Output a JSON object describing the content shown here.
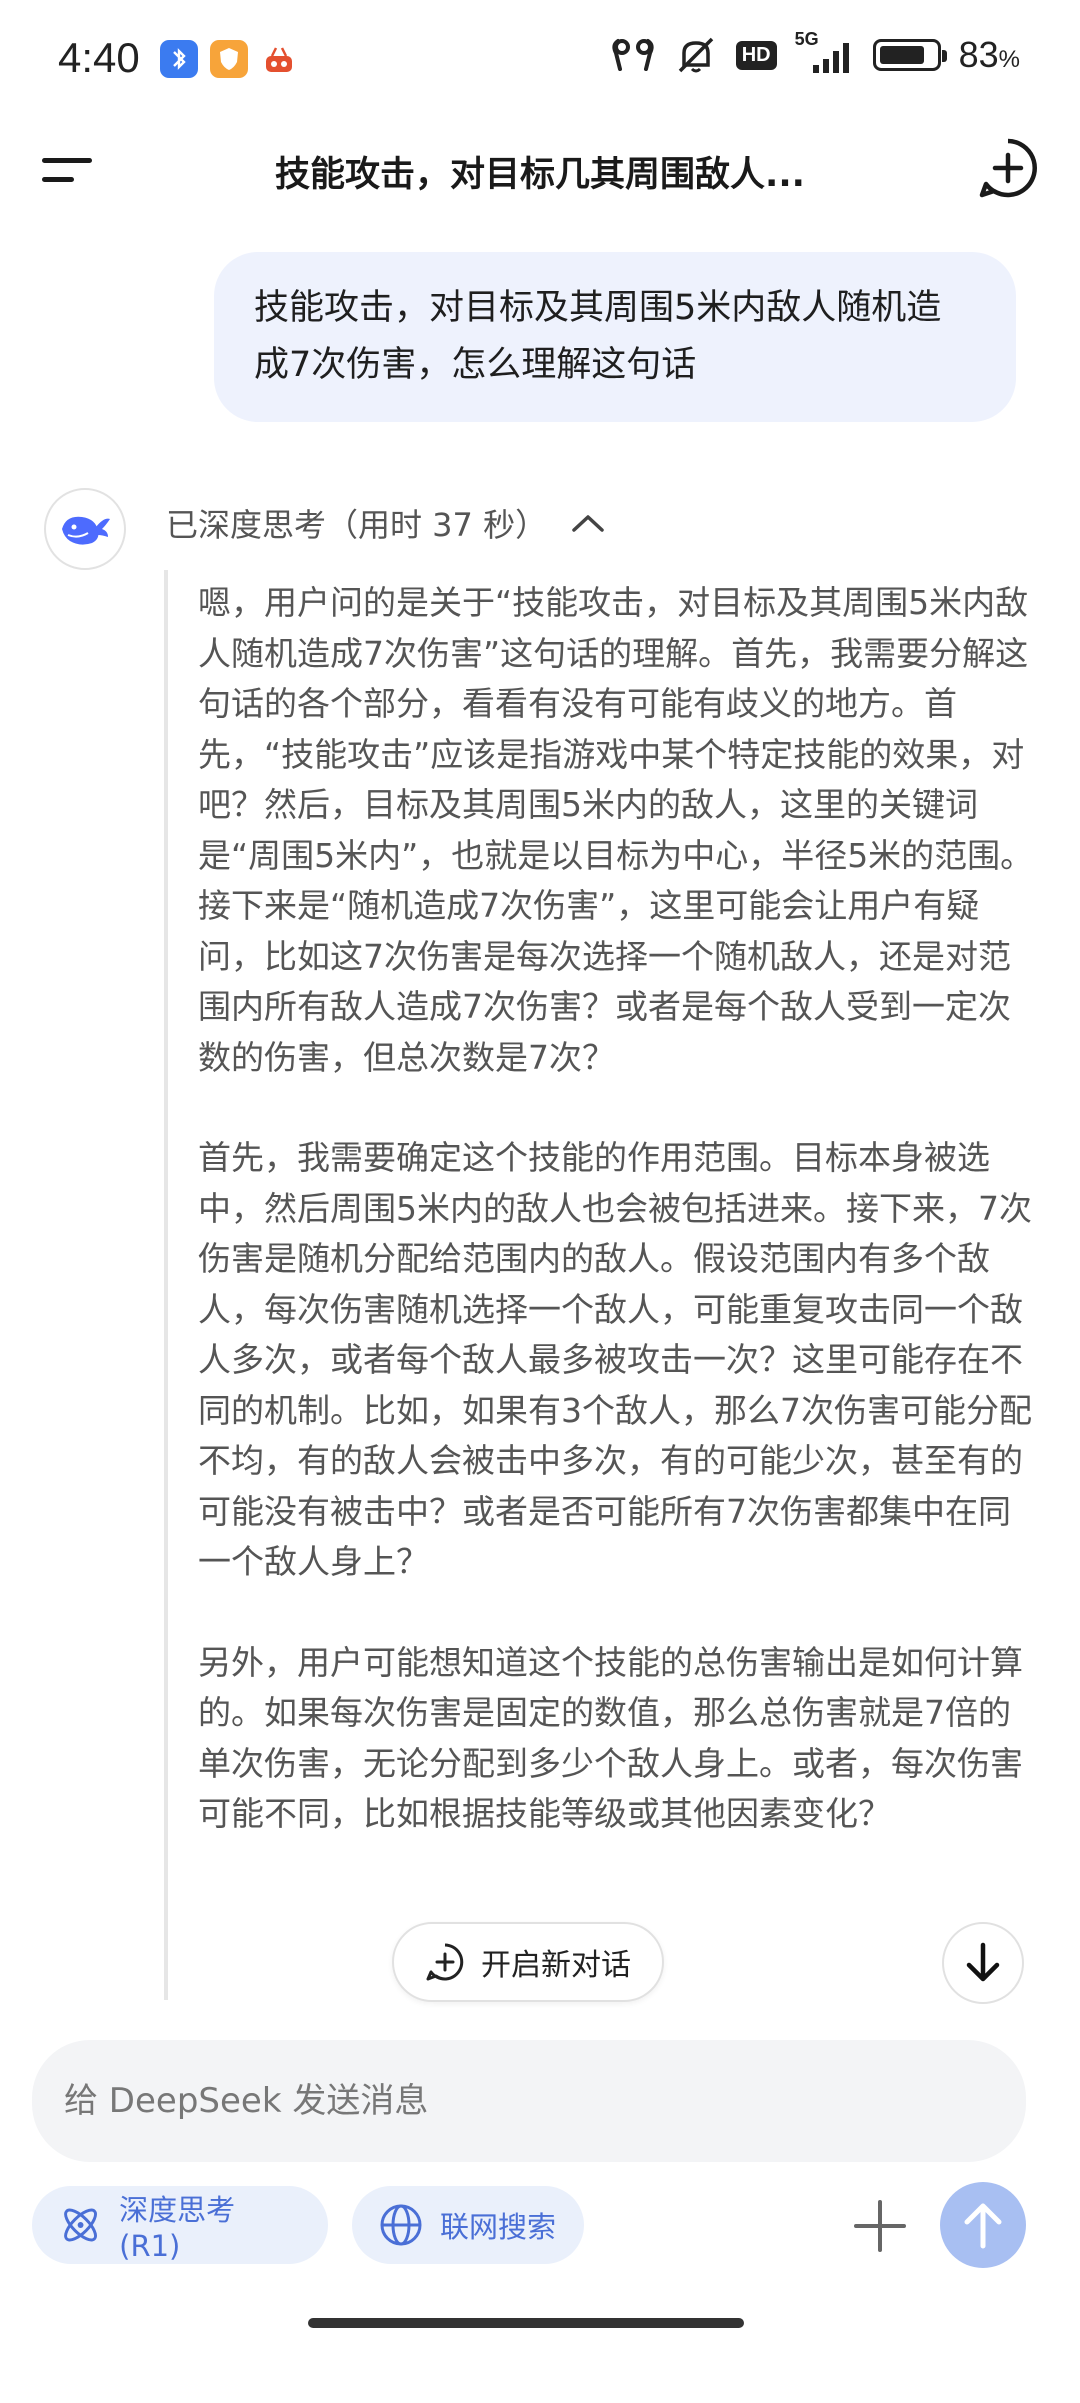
{
  "status_bar": {
    "time": "4:40",
    "network": "5G",
    "hd_badge": "HD",
    "battery_percent": "83",
    "battery_unit": "%",
    "battery_level": 0.83
  },
  "header": {
    "title": "技能攻击，对目标几其周围敌人..."
  },
  "user_message": {
    "text": "技能攻击，对目标及其周围5米内敌人随机造成7次伤害，怎么理解这句话"
  },
  "assistant": {
    "thinking_label": "已深度思考（用时 37 秒）",
    "thinking_paragraphs": [
      "嗯，用户问的是关于“技能攻击，对目标及其周围5米内敌人随机造成7次伤害”这句话的理解。首先，我需要分解这句话的各个部分，看看有没有可能有歧义的地方。首先，“技能攻击”应该是指游戏中某个特定技能的效果，对吧？然后，目标及其周围5米内的敌人，这里的关键词是“周围5米内”，也就是以目标为中心，半径5米的范围。接下来是“随机造成7次伤害”，这里可能会让用户有疑问，比如这7次伤害是每次选择一个随机敌人，还是对范围内所有敌人造成7次伤害？或者是每个敌人受到一定次数的伤害，但总次数是7次？",
      "首先，我需要确定这个技能的作用范围。目标本身被选中，然后周围5米内的敌人也会被包括进来。接下来，7次伤害是随机分配给范围内的敌人。假设范围内有多个敌人，每次伤害随机选择一个敌人，可能重复攻击同一个敌人多次，或者每个敌人最多被攻击一次？这里可能存在不同的机制。比如，如果有3个敌人，那么7次伤害可能分配不均，有的敌人会被击中多次，有的可能少次，甚至有的可能没有被击中？或者是否可能所有7次伤害都集中在同一个敌人身上？",
      "另外，用户可能想知道这个技能的总伤害输出是如何计算的。如果每次伤害是固定的数值，那么总伤害就是7倍的单次伤害，无论分配到多少个敌人身上。或者，每次伤害可能不同，比如根据技能等级或其他因素变化？"
    ]
  },
  "floating": {
    "new_chat_label": "开启新对话"
  },
  "composer": {
    "placeholder": "给 DeepSeek 发送消息",
    "deep_think_label": "深度思考 (R1)",
    "web_search_label": "联网搜索"
  },
  "colors": {
    "accent": "#4a6fd6",
    "bubble": "#eef2fd",
    "send": "#a8bff2"
  }
}
